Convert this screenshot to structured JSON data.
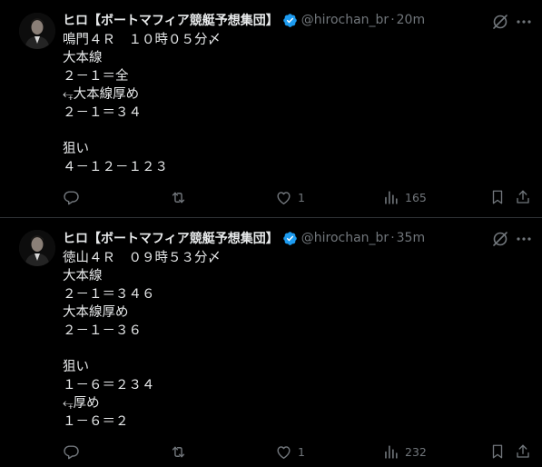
{
  "colors": {
    "background": "#000000",
    "text": "#e7e9ea",
    "muted": "#71767b",
    "divider": "#2f3336",
    "verified_blue": "#1d9bf0"
  },
  "posts": [
    {
      "author": {
        "display_name": "ヒロ【ボートマフィア競艇予想集団】",
        "handle": "@hirochan_br",
        "verified": true
      },
      "time": "20m",
      "lines": [
        "鳴門４Ｒ　１０時０５分〆",
        "大本線",
        "２－１＝全",
        "⥆大本線厚め",
        "２－１＝３４",
        "",
        "狙い",
        "４－１２－１２３"
      ],
      "stats": {
        "replies": "",
        "reposts": "",
        "likes": "1",
        "views": "165"
      }
    },
    {
      "author": {
        "display_name": "ヒロ【ボートマフィア競艇予想集団】",
        "handle": "@hirochan_br",
        "verified": true
      },
      "time": "35m",
      "lines": [
        "徳山４Ｒ　０９時５３分〆",
        "大本線",
        "２－１＝３４６",
        "大本線厚め",
        "２－１－３６",
        "",
        "狙い",
        "１－６＝２３４",
        "⥆厚め",
        "１－６＝２"
      ],
      "stats": {
        "replies": "",
        "reposts": "",
        "likes": "1",
        "views": "232"
      }
    }
  ]
}
